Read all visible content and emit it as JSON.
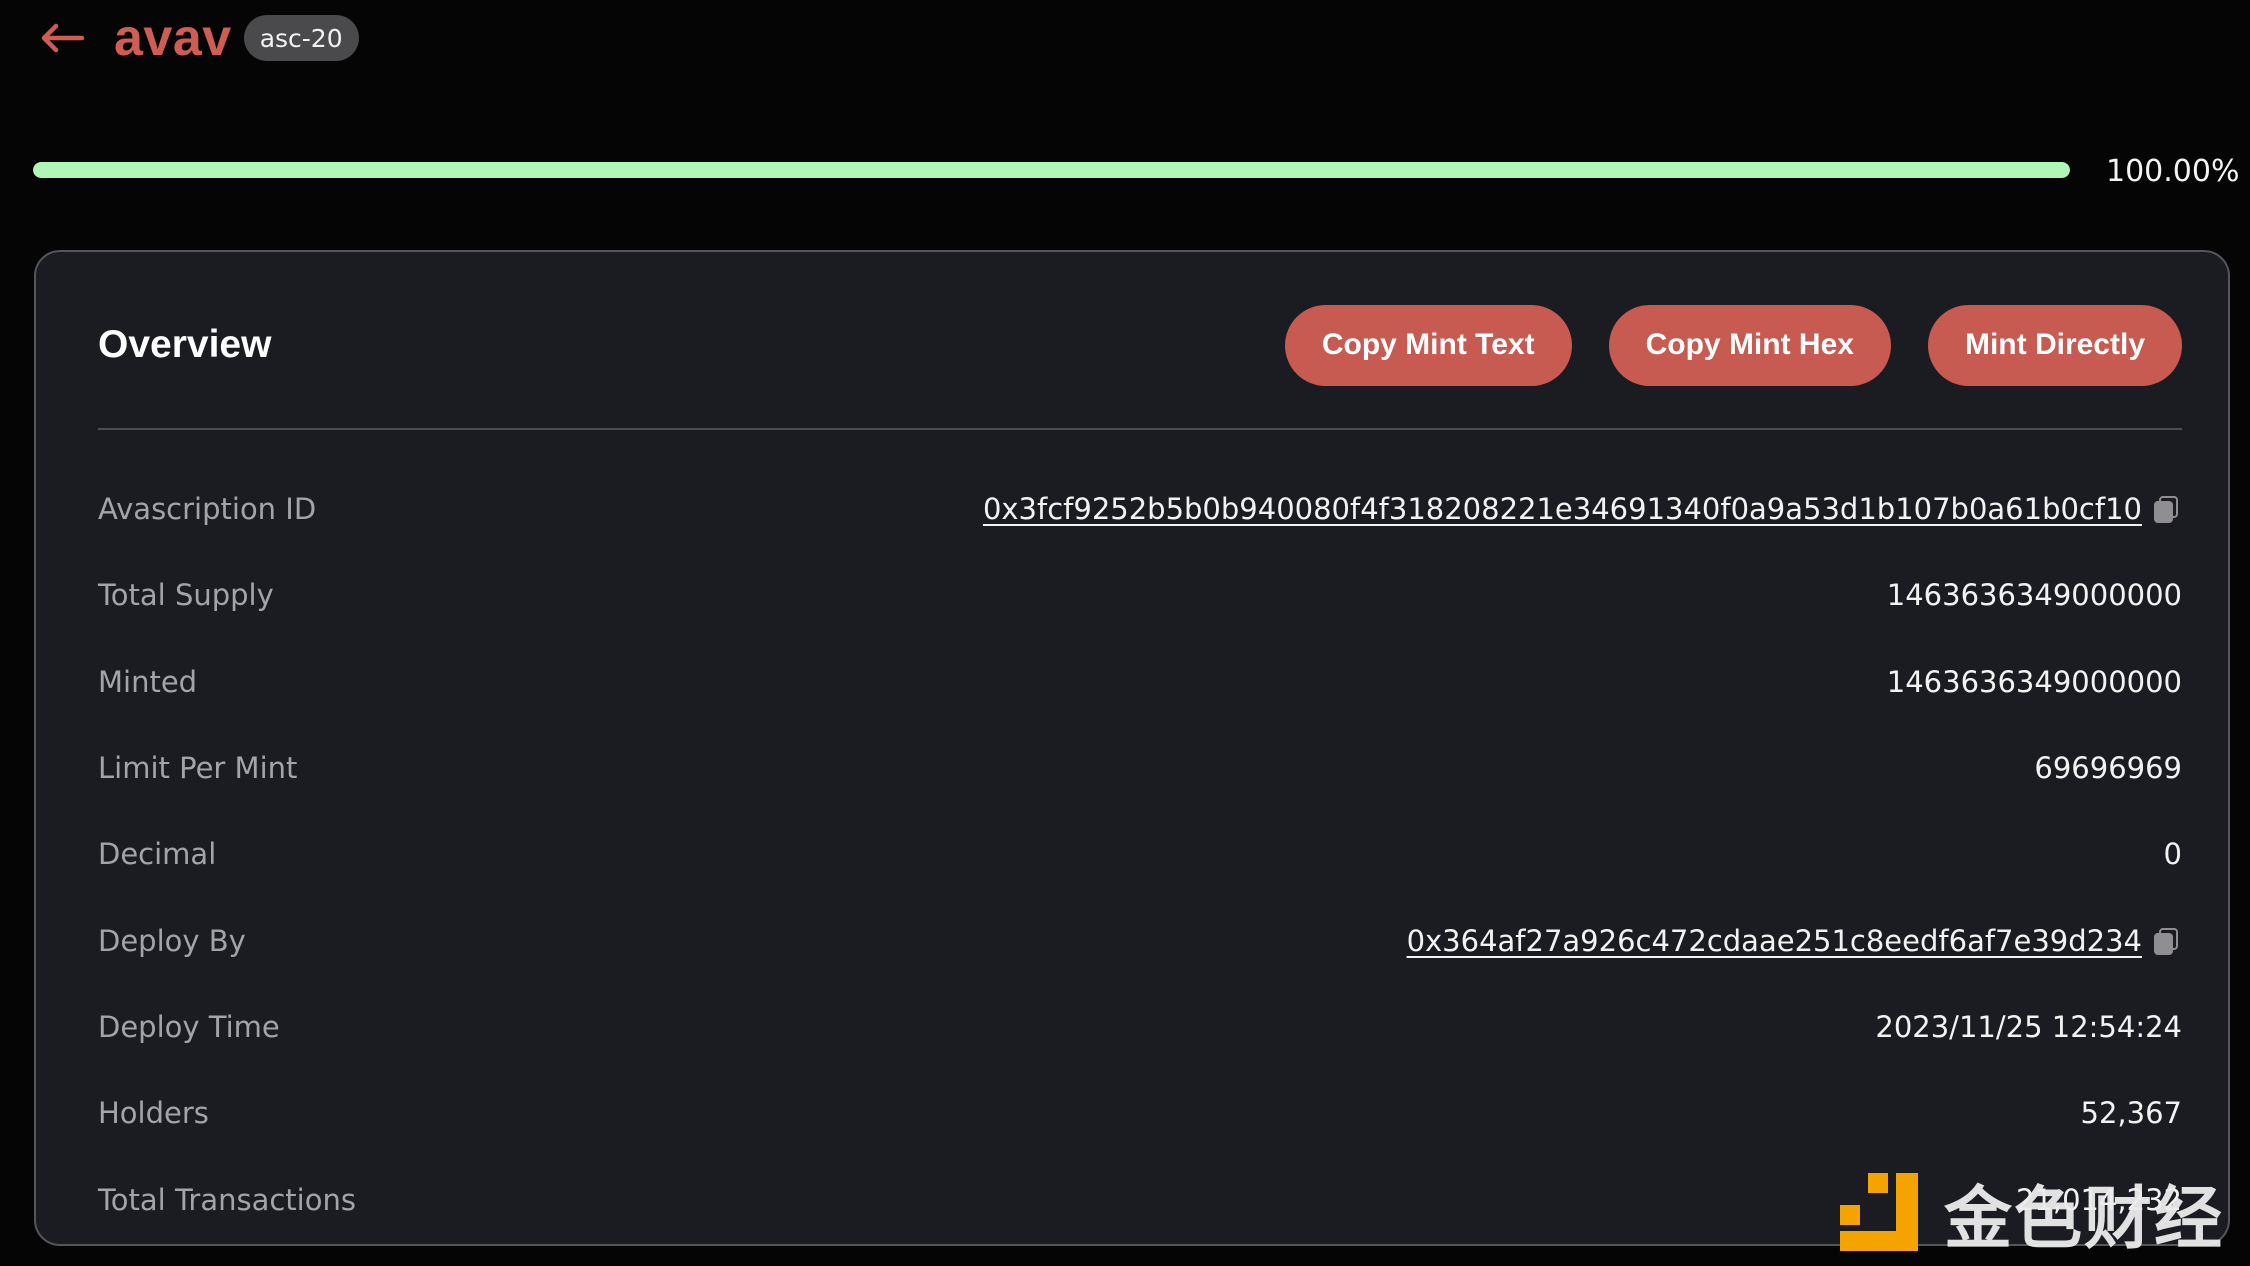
{
  "header": {
    "back_icon": "arrow-left-icon",
    "title": "avav",
    "badge": "asc-20"
  },
  "progress": {
    "value_percent": 100,
    "label": "100.00%"
  },
  "overview": {
    "title": "Overview",
    "buttons": {
      "copy_mint_text": "Copy Mint Text",
      "copy_mint_hex": "Copy Mint Hex",
      "mint_directly": "Mint Directly"
    },
    "rows": [
      {
        "label": "Avascription ID",
        "value": "0x3fcf9252b5b0b940080f4f318208221e34691340f0a9a53d1b107b0a61b0cf10",
        "link": true,
        "copy": true
      },
      {
        "label": "Total Supply",
        "value": "1463636349000000"
      },
      {
        "label": "Minted",
        "value": "1463636349000000"
      },
      {
        "label": "Limit Per Mint",
        "value": "69696969"
      },
      {
        "label": "Decimal",
        "value": "0"
      },
      {
        "label": "Deploy By",
        "value": "0x364af27a926c472cdaae251c8eedf6af7e39d234",
        "link": true,
        "copy": true
      },
      {
        "label": "Deploy Time",
        "value": "2023/11/25 12:54:24"
      },
      {
        "label": "Holders",
        "value": "52,367"
      },
      {
        "label": "Total Transactions",
        "value": "21,014,232"
      }
    ]
  },
  "watermark": {
    "text": "金色财经"
  },
  "colors": {
    "accent": "#c75b52",
    "title": "#cf5d54",
    "progress": "#b0f7b5",
    "card_bg": "#1b1c21",
    "page_bg": "#050505",
    "watermark_logo": "#f5a300"
  }
}
